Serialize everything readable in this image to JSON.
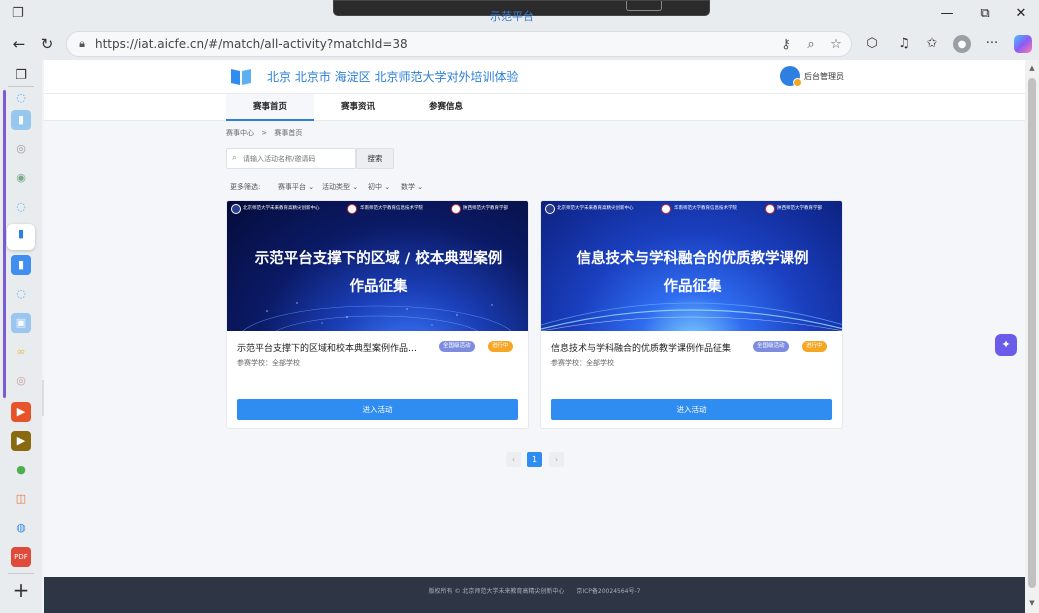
{
  "browser": {
    "tab_title_fragment": "示范平台",
    "url": "https://iat.aicfe.cn/#/match/all-activity?matchId=38"
  },
  "site": {
    "title": "北京 北京市 海淀区 北京师范大学对外培训体验",
    "admin_label": "后台管理员"
  },
  "nav": {
    "tabs": [
      {
        "label": "赛事首页",
        "active": true
      },
      {
        "label": "赛事资讯",
        "active": false
      },
      {
        "label": "参赛信息",
        "active": false
      }
    ]
  },
  "breadcrumb": {
    "root": "赛事中心",
    "sep": ">",
    "current": "赛事首页"
  },
  "search": {
    "placeholder": "请输入活动名称/邀请码",
    "button": "搜索"
  },
  "filters": {
    "label": "更多筛选:",
    "items": [
      "赛事平台",
      "活动类型",
      "初中",
      "数学"
    ]
  },
  "cards": [
    {
      "banner_line1": "示范平台支撑下的区域 / 校本典型案例",
      "banner_line2": "作品征集",
      "org1": "北京师范大学未来教育高精尖创新中心",
      "org2": "华南师范大学教育信息技术学院",
      "org3": "陕西师范大学教育学部",
      "title": "示范平台支撑下的区域和校本典型案例作品…",
      "level_badge": "全国级活动",
      "status_badge": "进行中",
      "meta": "参赛学校：全部学校",
      "button": "进入活动"
    },
    {
      "banner_line1": "信息技术与学科融合的优质教学课例",
      "banner_line2": "作品征集",
      "org1": "北京师范大学未来教育高精尖创新中心",
      "org2": "华南师范大学教育信息技术学院",
      "org3": "陕西师范大学教育学部",
      "title": "信息技术与学科融合的优质教学课例作品征集",
      "level_badge": "全国级活动",
      "status_badge": "进行中",
      "meta": "参赛学校：全部学校",
      "button": "进入活动"
    }
  ],
  "pagination": {
    "prev": "‹",
    "current": "1",
    "next": "›"
  },
  "footer": {
    "text": "版权所有 © 北京师范大学未来教育高精尖创新中心　　京ICP备20024564号-7"
  },
  "colors": {
    "primary": "#2f8cf0",
    "status": "#f5a623",
    "level": "#7e8ce0",
    "footer_bg": "#2e3545"
  }
}
